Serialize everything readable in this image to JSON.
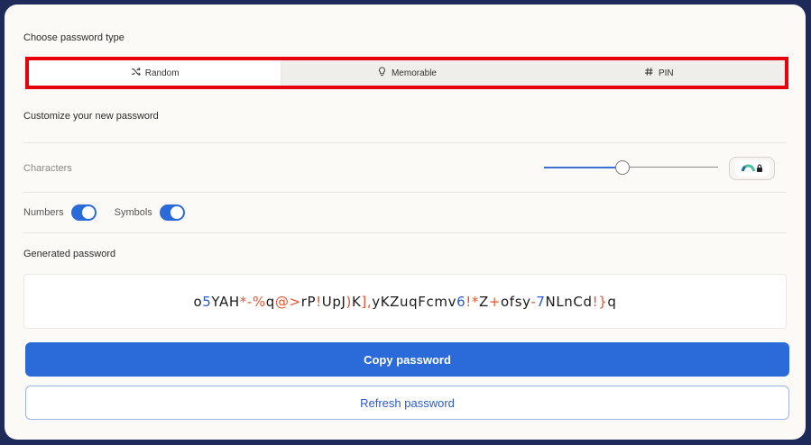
{
  "password_type": {
    "heading": "Choose password type",
    "tabs": [
      {
        "label": "Random",
        "icon": "shuffle-icon",
        "active": true
      },
      {
        "label": "Memorable",
        "icon": "lightbulb-icon",
        "active": false
      },
      {
        "label": "PIN",
        "icon": "hash-icon",
        "active": false
      }
    ]
  },
  "customize": {
    "heading": "Customize your new password",
    "characters_label": "Characters",
    "characters_slider_fraction": 0.45,
    "strength_icon": "strength-gauge-icon",
    "numbers_label": "Numbers",
    "numbers_on": true,
    "symbols_label": "Symbols",
    "symbols_on": true
  },
  "generated": {
    "heading": "Generated password",
    "password": "o5YAH*-%q@>rP!UpJ)K],yKZuqFcmv6!*Z+ofsy-7NLnCd!}q"
  },
  "actions": {
    "copy_label": "Copy password",
    "refresh_label": "Refresh password"
  },
  "colors": {
    "accent": "#2a6bd9",
    "number_color": "#2a5bd0",
    "symbol_color": "#e8532f",
    "highlight_border": "#e8000b"
  }
}
